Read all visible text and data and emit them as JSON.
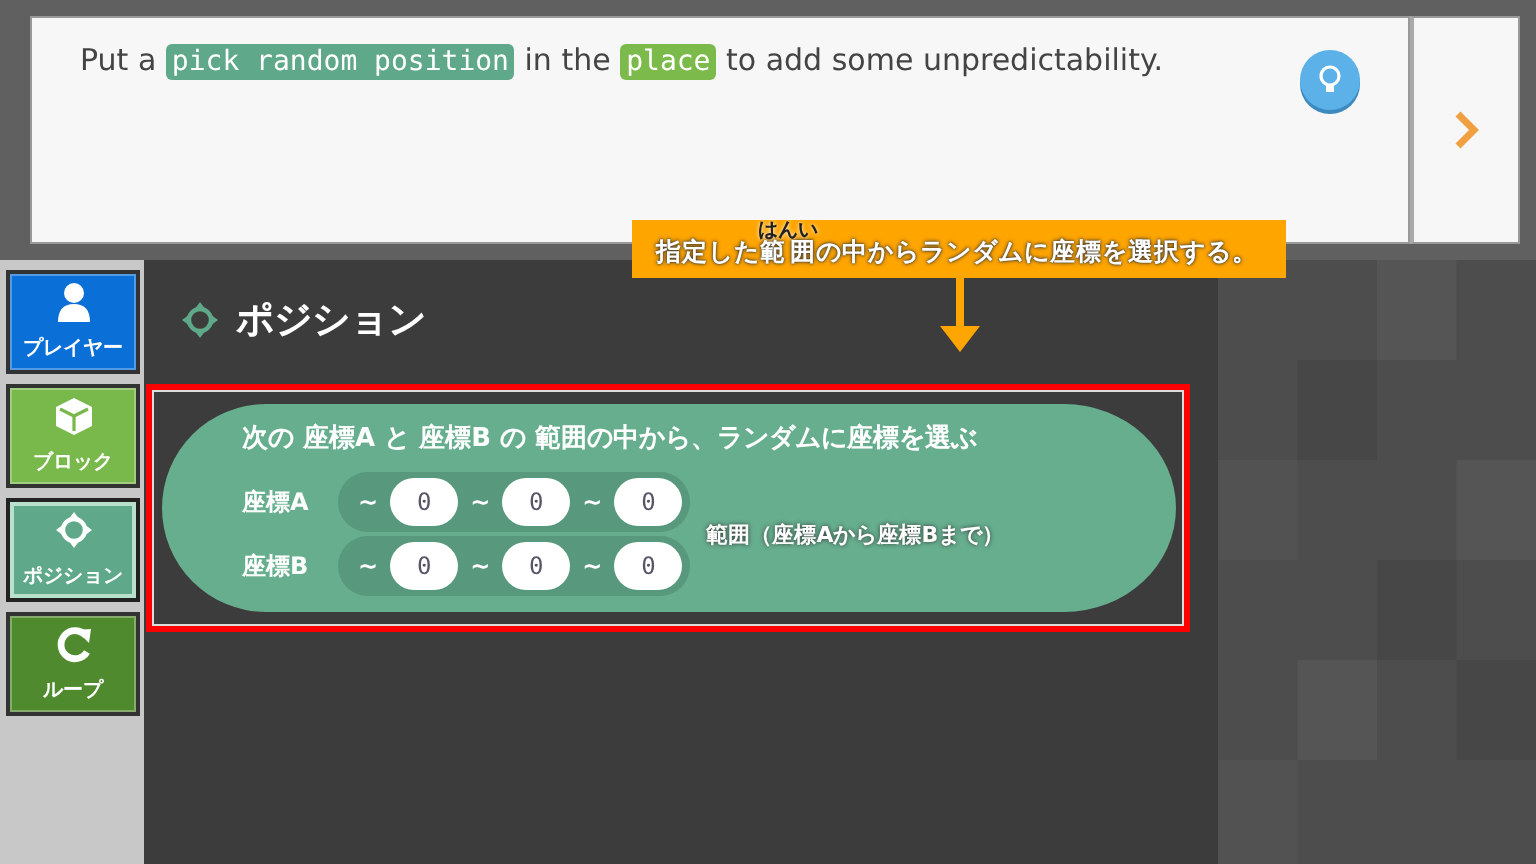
{
  "lesson": {
    "parts": [
      {
        "kind": "text",
        "text": "Put a "
      },
      {
        "kind": "code",
        "text": "pick random position",
        "color": "#5fa88a"
      },
      {
        "kind": "text",
        "text": " in the "
      },
      {
        "kind": "code",
        "text": "place",
        "color": "#7cba4c"
      },
      {
        "kind": "text",
        "text": " to add some unpredictability."
      }
    ]
  },
  "callout": {
    "before": "指定した",
    "ruby_base": "範囲",
    "ruby": "はんい",
    "after": "の中からランダムに座標を選択する。"
  },
  "sidebar": {
    "items": [
      {
        "label": "プレイヤー",
        "kind": "person",
        "color": "#0b6fd8",
        "selected": false
      },
      {
        "label": "ブロック",
        "kind": "cube",
        "color": "#79b84a",
        "selected": false
      },
      {
        "label": "ポジション",
        "kind": "target",
        "color": "#5fa88a",
        "selected": true
      },
      {
        "label": "ループ",
        "kind": "loop",
        "color": "#4f8a2f",
        "selected": false
      }
    ]
  },
  "category_title": "ポジション",
  "block": {
    "header": "次の 座標A と 座標B の 範囲の中から、ランダムに座標を選ぶ",
    "rows": [
      {
        "label": "座標A",
        "fields": [
          {
            "prefix": "~",
            "value": "0"
          },
          {
            "prefix": "~",
            "value": "0"
          },
          {
            "prefix": "~",
            "value": "0"
          }
        ]
      },
      {
        "label": "座標B",
        "fields": [
          {
            "prefix": "~",
            "value": "0"
          },
          {
            "prefix": "~",
            "value": "0"
          },
          {
            "prefix": "~",
            "value": "0"
          }
        ]
      }
    ],
    "note": "範囲（座標Aから座標Bまで）"
  }
}
